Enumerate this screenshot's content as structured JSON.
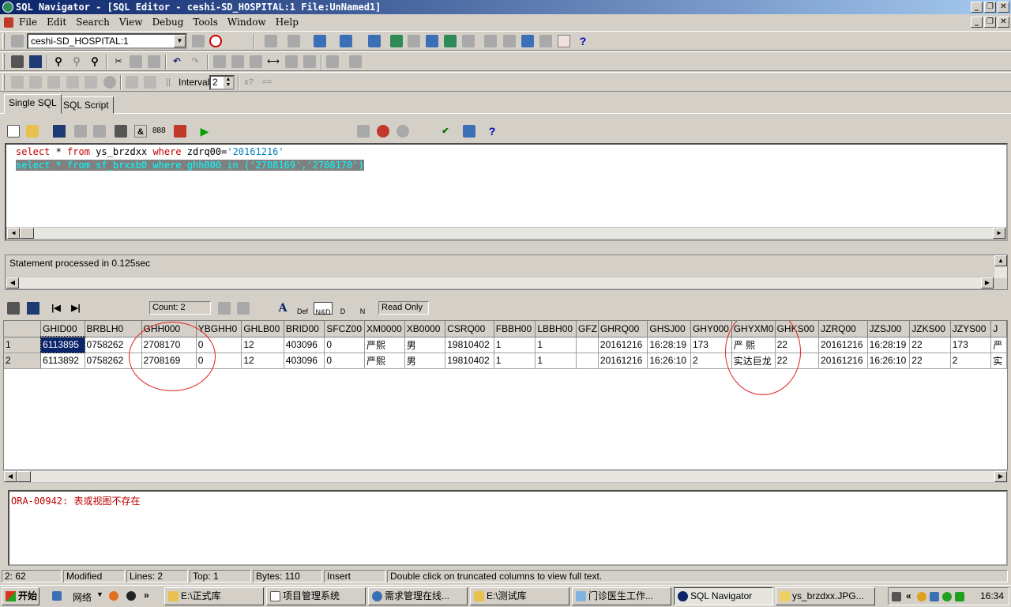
{
  "window": {
    "title": "SQL Navigator - [SQL Editor - ceshi-SD_HOSPITAL:1 File:UnNamed1]",
    "min_icon": "_",
    "restore_icon": "❐",
    "close_icon": "✕"
  },
  "menu": {
    "items": [
      "File",
      "Edit",
      "Search",
      "View",
      "Debug",
      "Tools",
      "Window",
      "Help"
    ]
  },
  "toolbar1": {
    "connection": "ceshi-SD_HOSPITAL:1",
    "help": "?"
  },
  "toolbar3": {
    "interval_label": "Interval:",
    "interval_value": "2"
  },
  "tabs": [
    "Single SQL",
    "SQL Script"
  ],
  "editor": {
    "line1": {
      "kw1": "select",
      "mid1": " * ",
      "kw2": "from",
      "mid2": " ys_brzdxx ",
      "kw3": "where",
      "mid3": " zdrq00=",
      "str": "'20161216'"
    },
    "line2": "select * from sf_brxxb0 where ghh000 in ('2708169','2708170')"
  },
  "statement_status": "Statement processed in 0.125sec",
  "grid_toolbar": {
    "count": "Count: 2",
    "read_only": "Read Only",
    "def_label": "Def",
    "nd_label": "N&D",
    "d_label": "D",
    "n_label": "N"
  },
  "grid": {
    "columns": [
      "GHID00",
      "BRBLH0",
      "GHH000",
      "YBGHH0",
      "GHLB00",
      "BRID00",
      "SFCZ00",
      "XM0000",
      "XB0000",
      "CSRQ00",
      "FBBH00",
      "LBBH00",
      "GFZ",
      "GHRQ00",
      "GHSJ00",
      "GHY000",
      "GHYXM0",
      "GHKS00",
      "JZRQ00",
      "JZSJ00",
      "JZKS00",
      "JZYS00",
      "J"
    ],
    "rows": [
      {
        "num": "1",
        "cells": [
          "6113895",
          "0758262",
          "2708170",
          "0",
          "12",
          "403096",
          "0",
          "严熙",
          "男",
          "19810402",
          "1",
          "1",
          "",
          "20161216",
          "16:28:19",
          "173",
          "严 熙",
          "22",
          "20161216",
          "16:28:19",
          "22",
          "173",
          "严"
        ]
      },
      {
        "num": "2",
        "cells": [
          "6113892",
          "0758262",
          "2708169",
          "0",
          "12",
          "403096",
          "0",
          "严熙",
          "男",
          "19810402",
          "1",
          "1",
          "",
          "20161216",
          "16:26:10",
          "2",
          "实达巨龙",
          "22",
          "20161216",
          "16:26:10",
          "22",
          "2",
          "实"
        ]
      }
    ]
  },
  "output_message": "ORA-00942: 表或视图不存在",
  "statusbar": {
    "position": "2: 62",
    "modified": "Modified",
    "lines": "Lines: 2",
    "top": "Top: 1",
    "bytes": "Bytes: 110",
    "mode": "Insert",
    "hint": "Double click on truncated columns to view  full text."
  },
  "taskbar": {
    "start": "开始",
    "quicklaunch_label": "网络",
    "more": "»",
    "tasks": [
      "E:\\正式库",
      "项目管理系统",
      "需求管理在线...",
      "E:\\测试库",
      "门诊医生工作...",
      "SQL Navigator",
      "ys_brzdxx.JPG..."
    ],
    "clock": "16:34"
  }
}
